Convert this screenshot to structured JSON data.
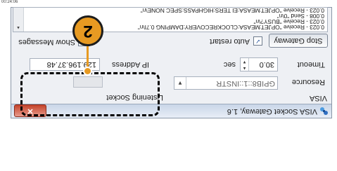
{
  "timestamp": "00:24:06",
  "window": {
    "title": "VISA Socket Gateway, 1.6",
    "close_icon": "✕"
  },
  "visa": {
    "section_label": "VISA",
    "resource_label": "Resource",
    "resource_value": "GPIB8::1::INSTR",
    "timeout_label": "Timeout",
    "timeout_value": "30.0",
    "timeout_unit": "sec"
  },
  "socket": {
    "section_label": "Listening Socket",
    "ip_label": "IP Address",
    "ip_value": "129.196.37.48"
  },
  "controls": {
    "stop_gateway": "Stop Gateway",
    "auto_restart": "Auto restart",
    "auto_restart_checked": true,
    "show_messages": "Show Messages",
    "show_messages_checked": true
  },
  "log_lines": [
    "0.023 - Receive \"OPJET:MEASA:CLOCKRECOVERY:DAMPING 0.7I\\n\"",
    "0.023 - Receive \"BUSY?\\n\"",
    "0.008 - Send \"0\\n\"",
    "0.023 - Receive \"OPJET:MEASA:EI TERS:HIGHPASS:SPEC NONE\\n\""
  ],
  "callout": {
    "number": "2"
  },
  "icons": {
    "app": "socket-app-icon",
    "chevron": "▼",
    "spin_up": "▲",
    "spin_down": "▼",
    "check": "✓"
  },
  "colors": {
    "callout_accent": "#e79a22",
    "close_button": "#c5432a"
  }
}
